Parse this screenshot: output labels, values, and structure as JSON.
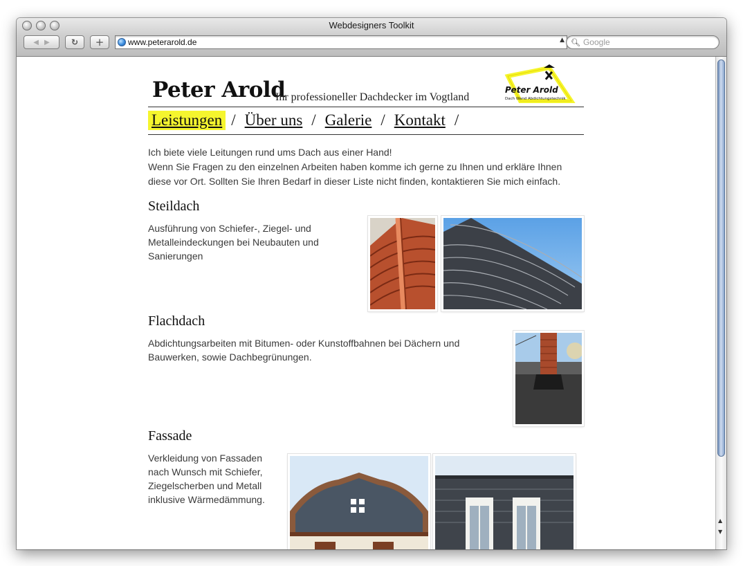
{
  "browser": {
    "title": "Webdesigners Toolkit",
    "url": "www.peterarold.de",
    "search_placeholder": "Google",
    "buttons": {
      "back_forward": "◀ ▶",
      "reload": "C",
      "add": "+"
    }
  },
  "site": {
    "brand": "Peter Arold",
    "tagline": "Ihr professioneller Dachdecker im Vogtland",
    "logo": {
      "name": "Peter Arold",
      "subtitle": "Dach Wand Abdichtungstechnik",
      "color": "#f5f52e"
    },
    "menu": [
      {
        "label": "Leistungen",
        "active": true
      },
      {
        "label": "Über uns",
        "active": false
      },
      {
        "label": "Galerie",
        "active": false
      },
      {
        "label": "Kontakt",
        "active": false
      }
    ],
    "menu_separator": "/",
    "intro": [
      "Ich biete viele Leitungen rund ums Dach aus einer Hand!",
      "Wenn Sie Fragen zu den einzelnen Arbeiten haben komme ich gerne zu Ihnen und erkläre Ihnen diese vor Ort. Sollten Sie Ihren Bedarf in dieser Liste nicht finden, kontaktieren Sie mich einfach."
    ],
    "sections": [
      {
        "title": "Steildach",
        "text": "Ausführung von Schiefer-, Ziegel- und Metalleindeckungen bei Neubauten und Sanierungen",
        "photos": [
          "red-tile-roof-photo",
          "slate-roof-photo"
        ]
      },
      {
        "title": "Flachdach",
        "text": "Abdichtungsarbeiten mit Bitumen- oder Kunstoffbahnen bei Dächern und Bauwerken, sowie Dachbegrünungen.",
        "photos": [
          "chimney-flat-roof-photo"
        ]
      },
      {
        "title": "Fassade",
        "text": "Verkleidung von Fassaden nach Wunsch mit Schiefer, Ziegelscherben und Metall inklusive Wärmedämmung.",
        "photos": [
          "gable-facade-photo",
          "slate-facade-windows-photo"
        ]
      }
    ]
  }
}
